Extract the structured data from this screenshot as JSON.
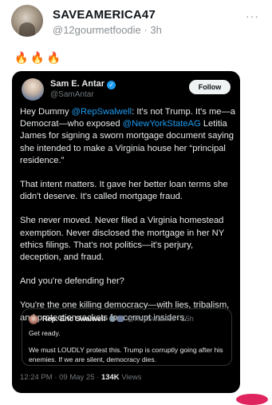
{
  "post": {
    "author_name": "SAVEAMERICA47",
    "handle": "@12gourmetfoodie",
    "separator": "·",
    "time": "3h",
    "more": "···",
    "emoji_text": "🔥🔥🔥"
  },
  "embedded": {
    "author_name": "Sam E. Antar",
    "verified_mark": "✓",
    "handle": "@SamAntar",
    "follow_label": "Follow",
    "p1": {
      "t1": "Hey Dummy ",
      "m1": "@RepSwalwell",
      "t2": ": It's not Trump. It's me—a Democrat—who exposed ",
      "m2": "@NewYorkStateAG",
      "t3": " Letitia James for signing a sworn mortgage document saying she intended to make a Virginia house her “principal residence.”"
    },
    "p2": "That intent matters. It gave her better loan terms she didn't deserve. It's called mortgage fraud.",
    "p3": "She never moved. Never filed a Virginia homestead exemption. Never disclosed the mortgage in her NY ethics filings. That's not politics—it's perjury, deception, and fraud.",
    "p4": "And you're defending her?",
    "p5": "You're the one killing democracy—with lies, tribalism, and protection rackets for corrupt insiders.",
    "quote": {
      "author_name": "Rep. Eric Swalwell",
      "handle": "@RepSwalwell",
      "separator": "·",
      "time": "15h",
      "line1": "Get ready.",
      "line2": "We must LOUDLY protest this. Trump is corruptly going after his enemies. If we are silent, democracy dies."
    },
    "footer": {
      "time": "12:24 PM",
      "separator": "·",
      "date": "09 May 25",
      "views_count": "134K",
      "views_label": "Views"
    }
  }
}
